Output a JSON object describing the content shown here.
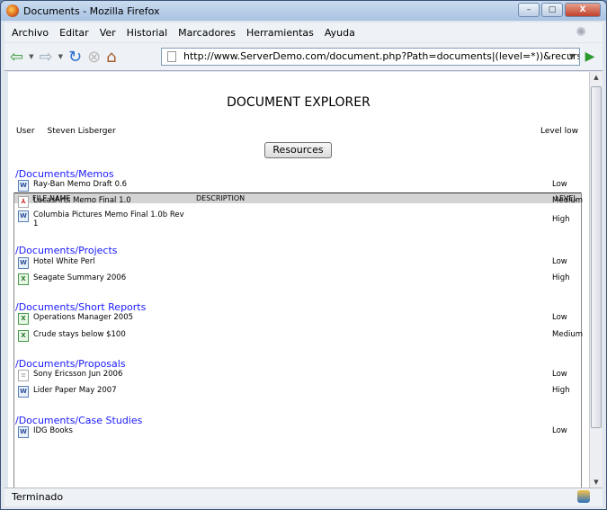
{
  "window": {
    "title": "Documents - Mozilla Firefox",
    "min": "–",
    "max": "□",
    "close": "X"
  },
  "menu": [
    "Archivo",
    "Editar",
    "Ver",
    "Historial",
    "Marcadores",
    "Herramientas",
    "Ayuda"
  ],
  "address": {
    "url": "http://www.ServerDemo.com/document.php?Path=documents|(level=*))&recursive=Yes"
  },
  "page": {
    "title": "DOCUMENT EXPLORER",
    "user_label": "User",
    "user_name": "Steven Lisberger",
    "level": "Level low",
    "resources_button": "Resources"
  },
  "table": {
    "headers": {
      "file_name": "FILE NAME",
      "description": "DESCRIPTION",
      "level": "LEVEL"
    },
    "groups": [
      {
        "path": "/Documents/Memos",
        "files": [
          {
            "name": "Ray-Ban Memo Draft 0.6",
            "type": "word",
            "level": "Low"
          },
          {
            "name": "LucasArts Memo Final 1.0",
            "type": "pdf",
            "level": "Medium"
          },
          {
            "name": "Columbia Pictures Memo Final 1.0b Rev 1",
            "type": "word",
            "level": "High"
          }
        ]
      },
      {
        "path": "/Documents/Projects",
        "files": [
          {
            "name": "Hotel White Perl",
            "type": "word",
            "level": "Low"
          },
          {
            "name": "Seagate Summary 2006",
            "type": "excel",
            "level": "High"
          }
        ]
      },
      {
        "path": "/Documents/Short Reports",
        "files": [
          {
            "name": "Operations Manager 2005",
            "type": "excel",
            "level": "Low"
          },
          {
            "name": "Crude stays below $100",
            "type": "excel",
            "level": "Medium"
          }
        ]
      },
      {
        "path": "/Documents/Proposals",
        "files": [
          {
            "name": "Sony Ericsson Jun 2006",
            "type": "text",
            "level": "Low"
          },
          {
            "name": "Lider Paper May 2007",
            "type": "word",
            "level": "High"
          }
        ]
      },
      {
        "path": "/Documents/Case Studies",
        "files": [
          {
            "name": "IDG Books",
            "type": "word",
            "level": "Low"
          }
        ]
      }
    ]
  },
  "status": {
    "text": "Terminado"
  }
}
